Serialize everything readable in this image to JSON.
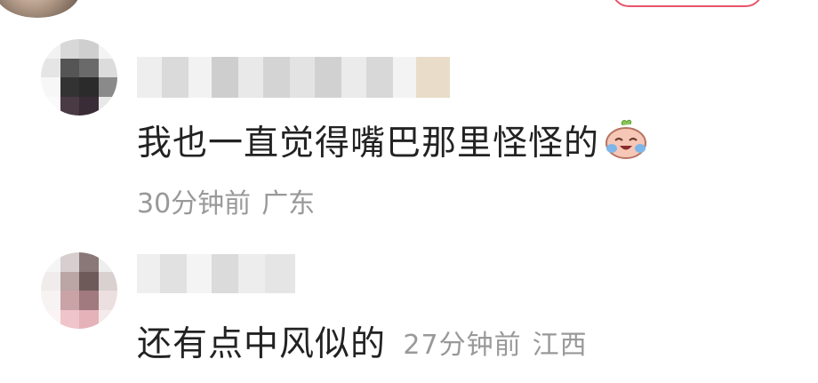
{
  "comments": [
    {
      "text": "我也一直觉得嘴巴那里怪怪的",
      "emoji": "laughing-crying-emoji",
      "time": "30分钟前",
      "location": "广东"
    },
    {
      "text": "还有点中风似的",
      "time": "27分钟前",
      "location": "江西"
    }
  ],
  "colors": {
    "text": "#222222",
    "meta": "#999999",
    "accent": "#e9556a"
  }
}
